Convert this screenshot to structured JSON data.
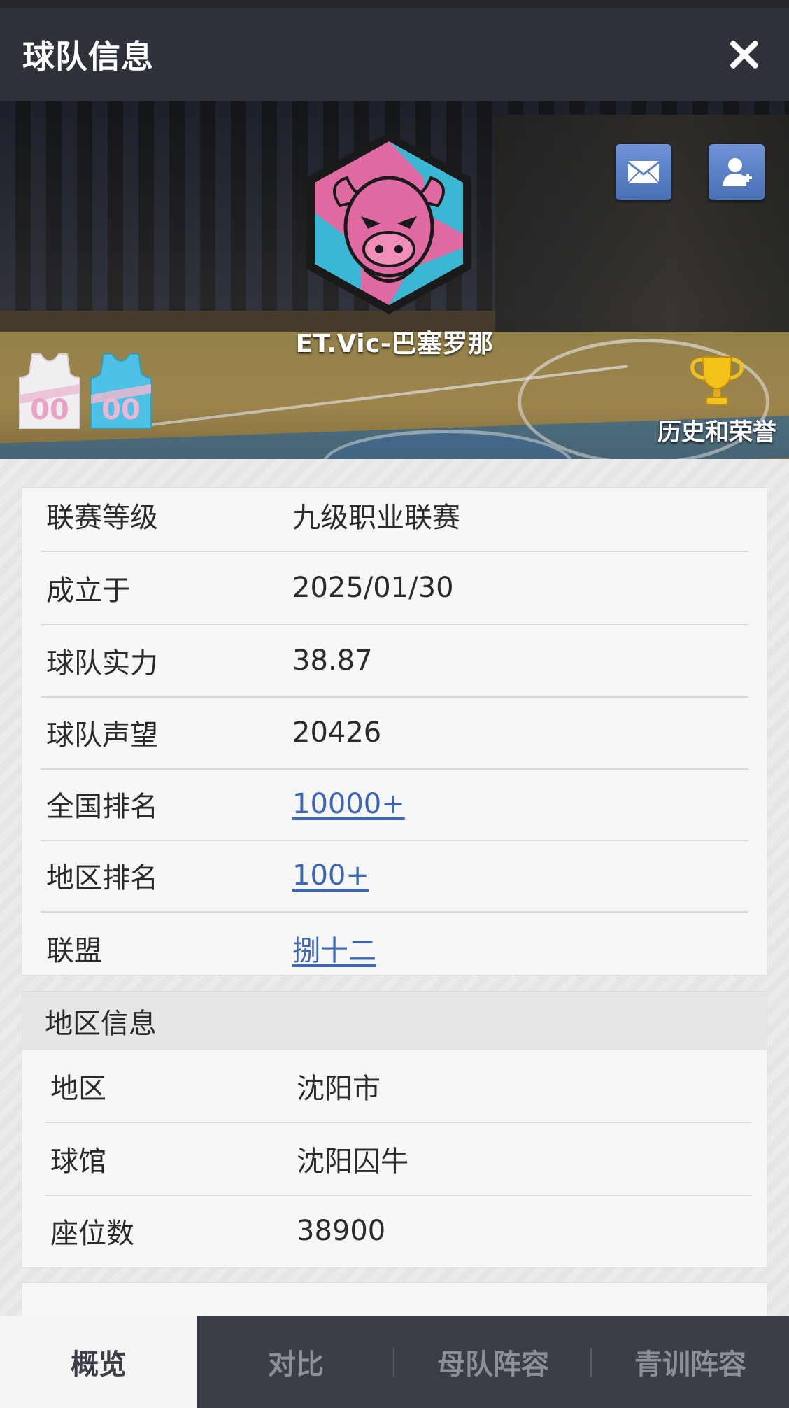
{
  "header": {
    "title": "球队信息",
    "close_icon": "close-icon"
  },
  "banner": {
    "team_name": "ET.Vic-巴塞罗那",
    "mail_icon": "mail-icon",
    "add_user_icon": "add-user-icon",
    "home_jersey_number": "00",
    "away_jersey_number": "00",
    "honor_label": "历史和荣誉",
    "trophy_icon": "trophy-icon"
  },
  "basic_info": [
    {
      "key": "联赛等级",
      "value": "九级职业联赛",
      "link": false
    },
    {
      "key": "成立于",
      "value": "2025/01/30",
      "link": false
    },
    {
      "key": "球队实力",
      "value": "38.87",
      "link": false
    },
    {
      "key": "球队声望",
      "value": "20426",
      "link": false
    },
    {
      "key": "全国排名",
      "value": "10000+",
      "link": true
    },
    {
      "key": "地区排名",
      "value": "100+",
      "link": true
    },
    {
      "key": "联盟",
      "value": "捌十二",
      "link": true
    }
  ],
  "region_info": {
    "title": "地区信息",
    "rows": [
      {
        "key": "地区",
        "value": "沈阳市"
      },
      {
        "key": "球馆",
        "value": "沈阳囚牛"
      },
      {
        "key": "座位数",
        "value": "38900"
      }
    ]
  },
  "bottom_nav": {
    "tabs": [
      {
        "label": "概览",
        "active": true
      },
      {
        "label": "对比",
        "active": false
      },
      {
        "label": "母队阵容",
        "active": false
      },
      {
        "label": "青训阵容",
        "active": false
      }
    ]
  },
  "colors": {
    "header_bg": "#2f323a",
    "link": "#3a66b5",
    "logo_pink": "#e06aa2",
    "logo_cyan": "#3ab7d3",
    "nav_bg": "#3b3e46"
  }
}
